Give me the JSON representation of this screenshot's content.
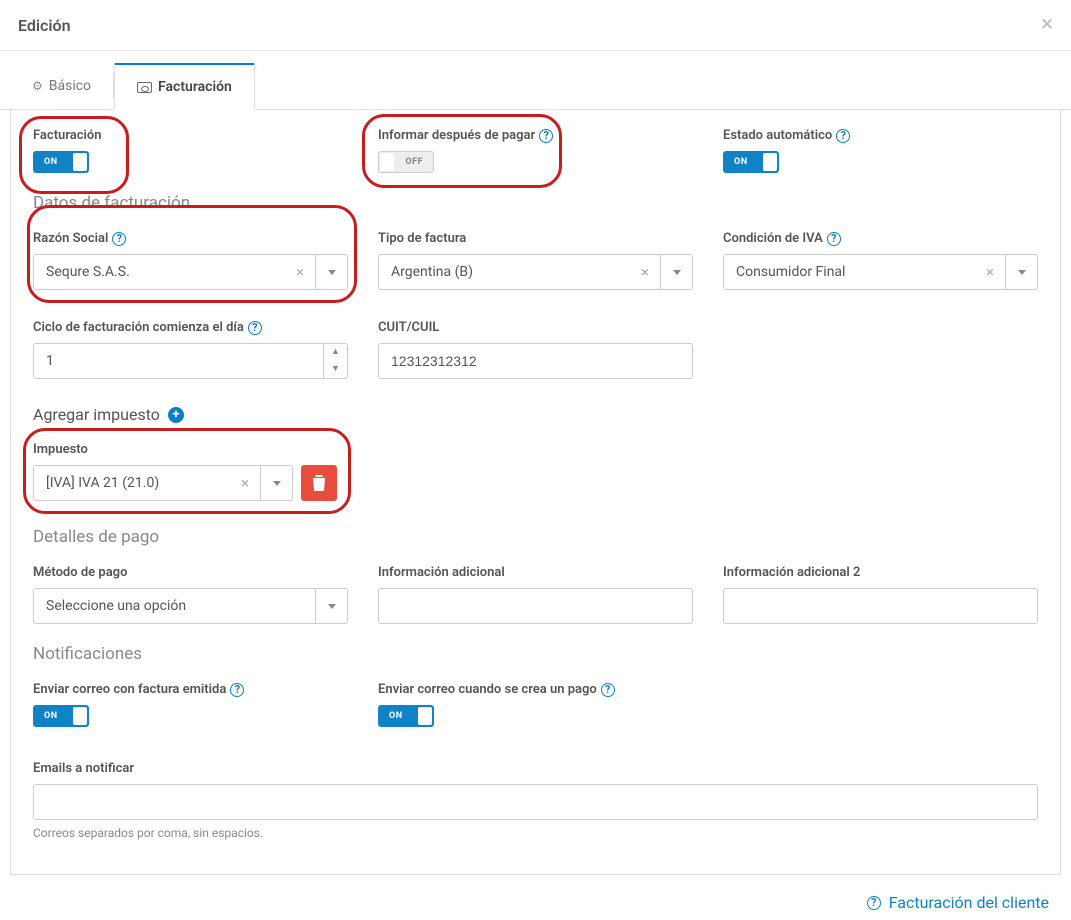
{
  "header": {
    "title": "Edición"
  },
  "tabs": {
    "basic": "Básico",
    "billing": "Facturación"
  },
  "toggles": {
    "on_text": "ON",
    "off_text": "OFF"
  },
  "top_switches": {
    "billing_label": "Facturación",
    "billing_on": true,
    "inform_label": "Informar después de pagar",
    "inform_on": false,
    "auto_state_label": "Estado automático",
    "auto_state_on": true
  },
  "sections": {
    "billing_data": "Datos de facturación",
    "add_tax": "Agregar impuesto",
    "payment_details": "Detalles de pago",
    "notifications": "Notificaciones"
  },
  "fields": {
    "razon_social": {
      "label": "Razón Social",
      "value": "Sequre S.A.S."
    },
    "tipo_factura": {
      "label": "Tipo de factura",
      "value": "Argentina (B)"
    },
    "cond_iva": {
      "label": "Condición de IVA",
      "value": "Consumidor Final"
    },
    "ciclo": {
      "label": "Ciclo de facturación comienza el día",
      "value": "1"
    },
    "cuit": {
      "label": "CUIT/CUIL",
      "value": "12312312312"
    },
    "impuesto": {
      "label": "Impuesto",
      "value": "[IVA] IVA 21 (21.0)"
    },
    "metodo_pago": {
      "label": "Método de pago",
      "placeholder": "Seleccione una opción"
    },
    "info1": {
      "label": "Información adicional"
    },
    "info2": {
      "label": "Información adicional 2"
    },
    "send_invoice_mail": {
      "label": "Enviar correo con factura emitida",
      "on": true
    },
    "send_payment_mail": {
      "label": "Enviar correo cuando se crea un pago",
      "on": true
    },
    "emails": {
      "label": "Emails a notificar",
      "helper": "Correos separados por coma, sin espacios."
    }
  },
  "footer": {
    "link_text": "Facturación del cliente"
  }
}
